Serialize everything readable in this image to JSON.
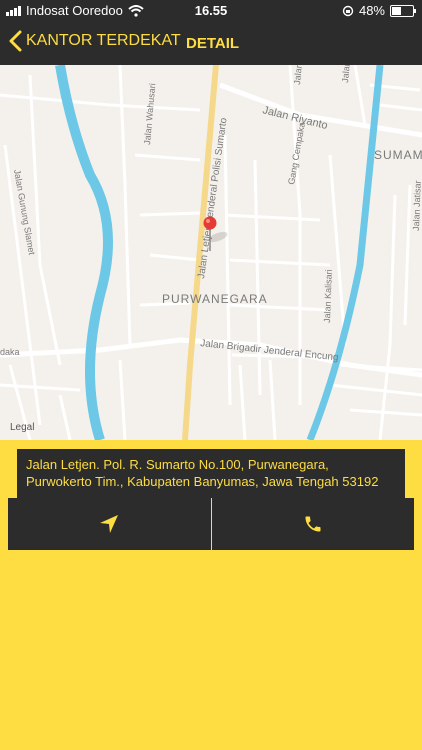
{
  "status_bar": {
    "carrier": "Indosat Ooredoo",
    "time": "16.55",
    "battery": "48%",
    "battery_level": 0.48
  },
  "nav": {
    "back_label": "KANTOR TERDEKAT",
    "title": "DETAIL"
  },
  "map": {
    "labels": {
      "jalan_riyanto": "Jalan Riyanto",
      "sumam": "SUMAM",
      "jalan_serayu": "Jalan Sera",
      "jalan_kenanga": "Jalan Kenang",
      "jalan_wahusari": "Jalan Wahusari",
      "jalan_sumarto": "Jalan Letjen Jenderal Polisi Sumarto",
      "gang_cempaka": "Gang Cempaka",
      "jalan_gunung_slamet": "Jalan Gunung Slamet",
      "purwanegara": "PURWANEGARA",
      "jalan_kalisari": "Jalan Kalisari",
      "jalan_jatisari": "Jalan Jatisar",
      "jalan_brigadir": "Jalan Brigadir Jenderal Encung",
      "daka": "daka",
      "legal": "Legal"
    },
    "colors": {
      "land": "#f4f1ec",
      "road": "#ffffff",
      "major_road": "#f5d88a",
      "river": "#6cc8e6",
      "label": "#7a7a7a",
      "pin": "#e53935"
    }
  },
  "address": "Jalan Letjen. Pol. R. Sumarto No.100, Purwanegara, Purwokerto Tim., Kabupaten Banyumas, Jawa Tengah 53192",
  "actions": {
    "directions_icon": "navigation-arrow-icon",
    "call_icon": "phone-icon"
  },
  "colors": {
    "accent": "#fddd42",
    "dark": "#2c2c2c"
  }
}
